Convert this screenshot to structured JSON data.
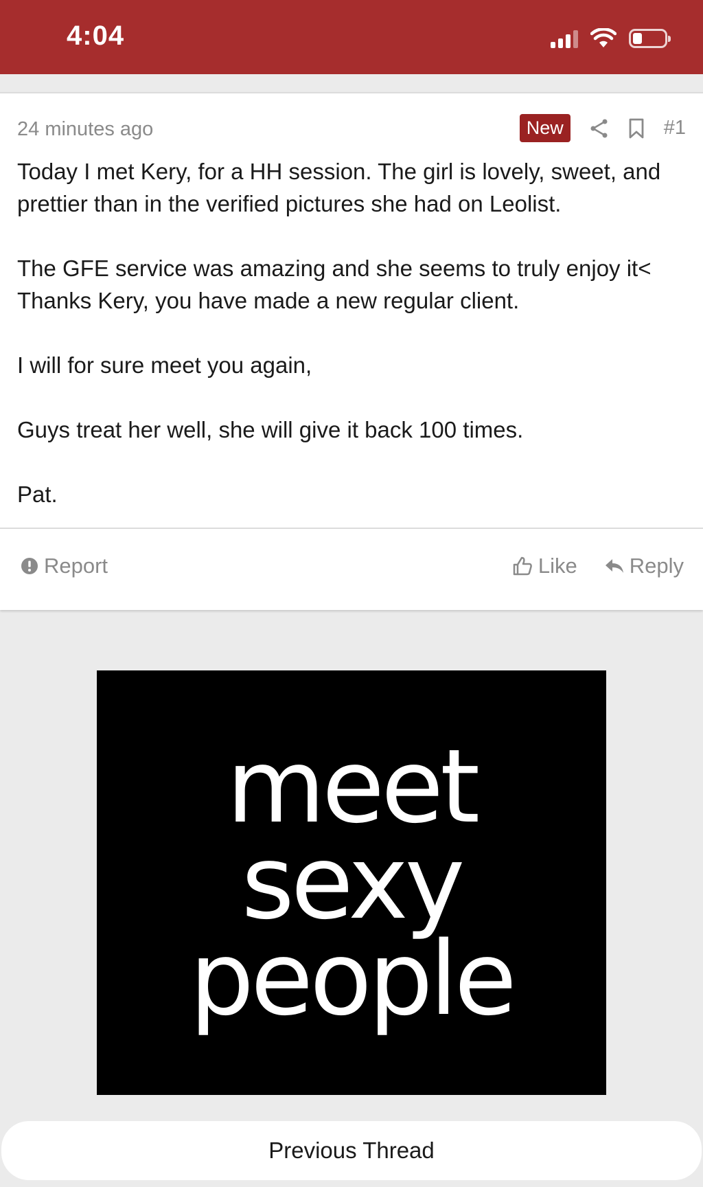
{
  "status_bar": {
    "time": "4:04"
  },
  "post": {
    "timestamp": "24 minutes ago",
    "badge": "New",
    "number": "#1",
    "paragraphs": [
      "Today I met Kery, for a HH session. The girl is lovely, sweet, and prettier than in the verified pictures she had on Leolist.",
      "The GFE service was amazing and she seems to truly enjoy it< Thanks Kery, you have made a new regular client.",
      "I will for sure meet you again,",
      "Guys treat her well, she will give it back 100 times.",
      "Pat."
    ],
    "actions": {
      "report": "Report",
      "like": "Like",
      "reply": "Reply"
    }
  },
  "ad": {
    "lines": [
      "meet",
      "sexy",
      "people"
    ]
  },
  "footer": {
    "previous_thread": "Previous Thread"
  },
  "colors": {
    "header": "#a62d2d",
    "badge": "#9a2222",
    "muted": "#8a8a8a"
  }
}
